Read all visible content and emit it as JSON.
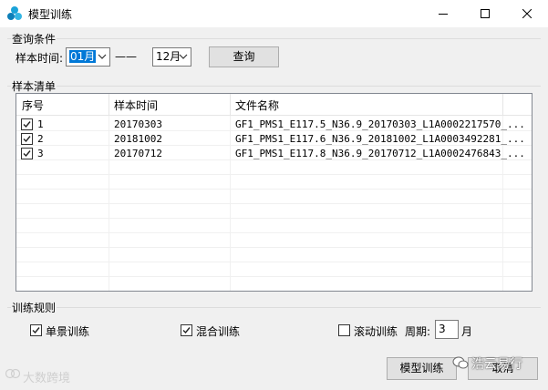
{
  "window": {
    "title": "模型训练",
    "accent_color": "#0078d7"
  },
  "query_group": {
    "title": "查询条件",
    "time_label": "样本时间:",
    "start_month": "01月",
    "range_separator": "——",
    "end_month": "12月",
    "query_button": "查询"
  },
  "sample_group": {
    "title": "样本清单",
    "columns": [
      "序号",
      "样本时间",
      "文件名称"
    ],
    "rows": [
      {
        "index": "1",
        "time": "20170303",
        "file": "GF1_PMS1_E117.5_N36.9_20170303_L1A0002217570_...",
        "checked": true
      },
      {
        "index": "2",
        "time": "20181002",
        "file": "GF1_PMS1_E117.6_N36.9_20181002_L1A0003492281_...",
        "checked": true
      },
      {
        "index": "3",
        "time": "20170712",
        "file": "GF1_PMS1_E117.8_N36.9_20170712_L1A0002476843_...",
        "checked": true
      }
    ]
  },
  "rule_group": {
    "title": "训练规则",
    "single_label": "单景训练",
    "single_checked": true,
    "mixed_label": "混合训练",
    "mixed_checked": true,
    "rolling_label": "滚动训练",
    "rolling_checked": false,
    "period_label": "周期:",
    "period_value": "3",
    "period_unit": "月"
  },
  "footer": {
    "train_button": "模型训练",
    "cancel_button": "取消"
  },
  "watermarks": {
    "left": "大数跨境",
    "right": "浩云易行"
  }
}
